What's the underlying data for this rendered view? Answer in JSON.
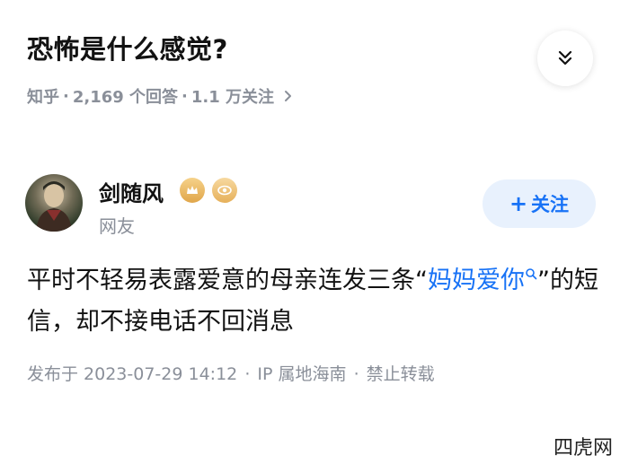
{
  "question": {
    "title": "恐怖是什么感觉?",
    "meta": {
      "source": "知乎",
      "answers": "2,169 个回答",
      "followers": "1.1 万关注",
      "sep": "·"
    }
  },
  "answer": {
    "author_name": "剑随风",
    "author_label": "网友",
    "follow_label": "关注",
    "content_prefix": "平时不轻易表露爱意的母亲连发三条“",
    "content_link": "妈妈爱你",
    "content_suffix": "”的短信，却不接电话不回消息",
    "published": "发布于 2023-07-29 14:12",
    "ip": "IP 属地海南",
    "repost": "禁止转载"
  },
  "watermark": "四虎网",
  "colors": {
    "accent": "#1772f6",
    "muted": "#8a8f99",
    "follow_bg": "#e8f1fd",
    "text": "#121212"
  },
  "icons": {
    "collapse": "double-chevron-down-icon",
    "meta_arrow": "chevron-right-icon",
    "badge1": "level-badge-icon",
    "badge2": "eye-badge-icon",
    "search": "search-icon"
  }
}
